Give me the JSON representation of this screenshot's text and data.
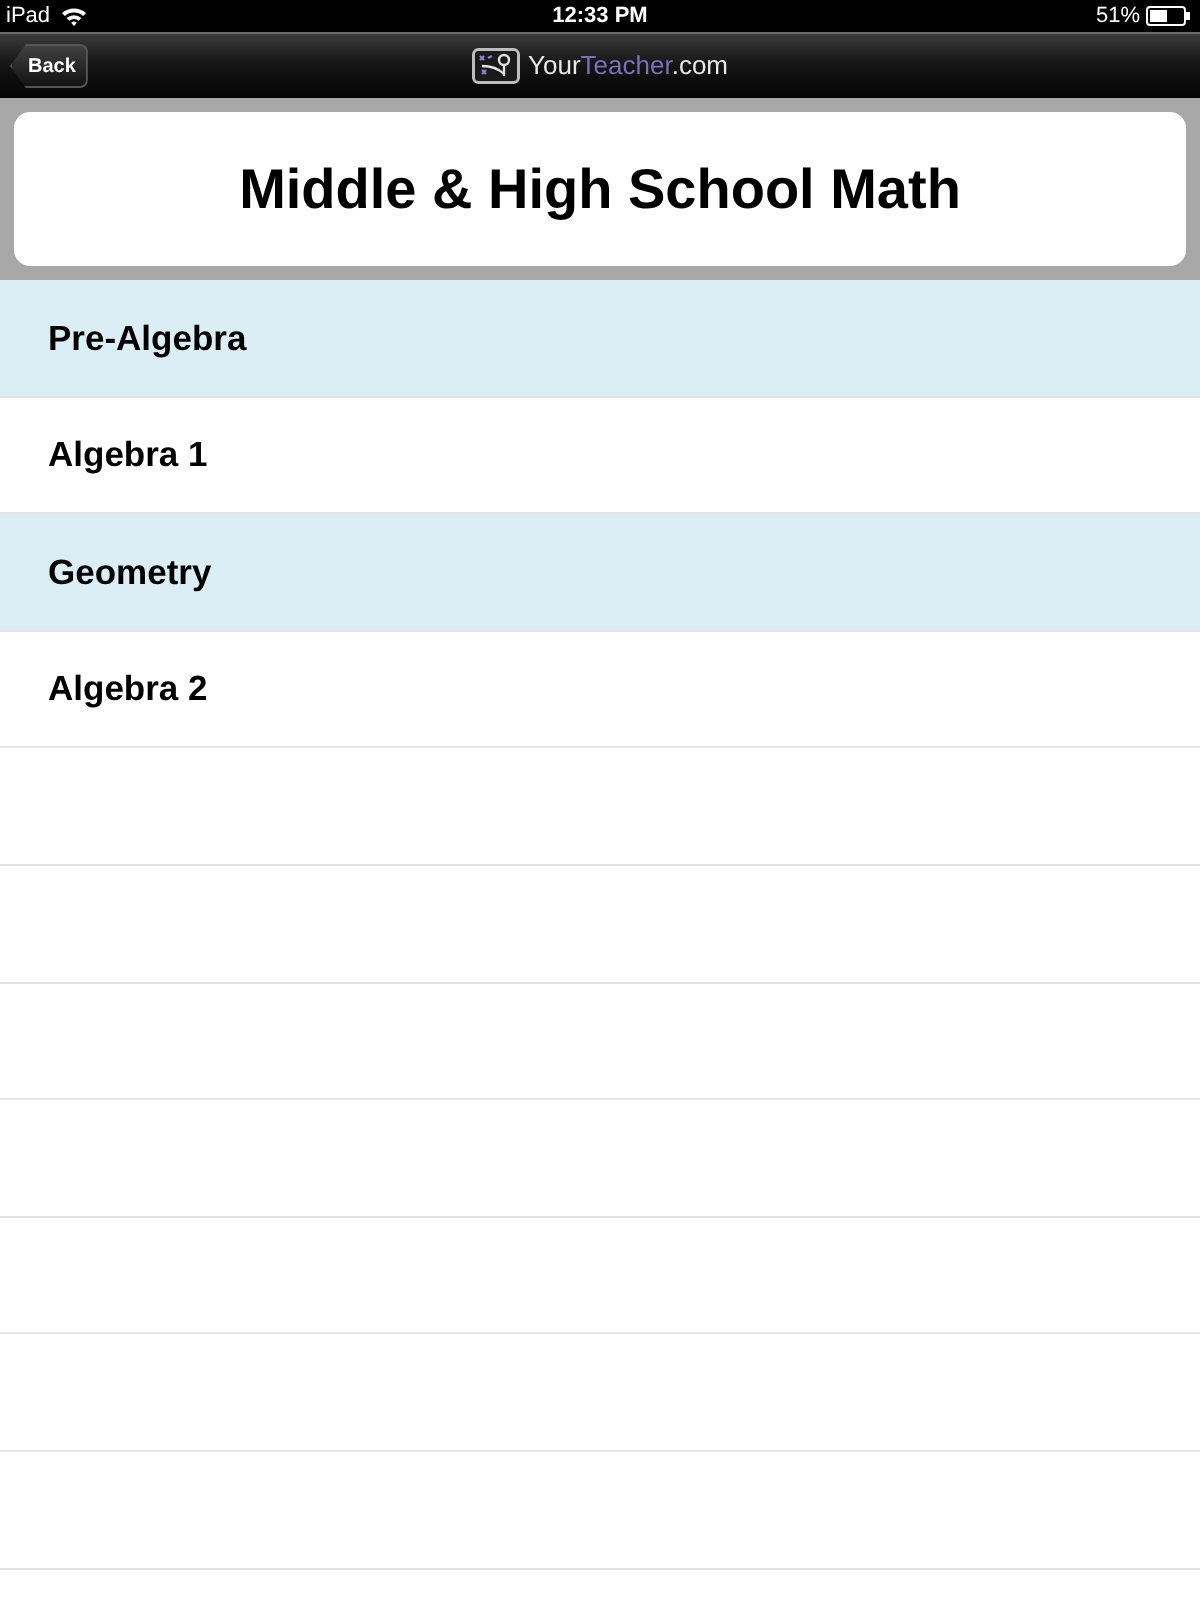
{
  "status_bar": {
    "device": "iPad",
    "time": "12:33 PM",
    "battery": "51%"
  },
  "nav_bar": {
    "back_button": "Back",
    "logo_parts": [
      {
        "text": "Your",
        "color": "#e8e8e8"
      },
      {
        "text": "Teacher",
        "color": "#7d70b8"
      },
      {
        "text": ".com",
        "color": "#e8e8e8"
      }
    ]
  },
  "header": {
    "title": "Middle & High School Math"
  },
  "list": {
    "items": [
      {
        "label": "Pre-Algebra"
      },
      {
        "label": "Algebra 1"
      },
      {
        "label": "Geometry"
      },
      {
        "label": "Algebra 2"
      }
    ]
  }
}
